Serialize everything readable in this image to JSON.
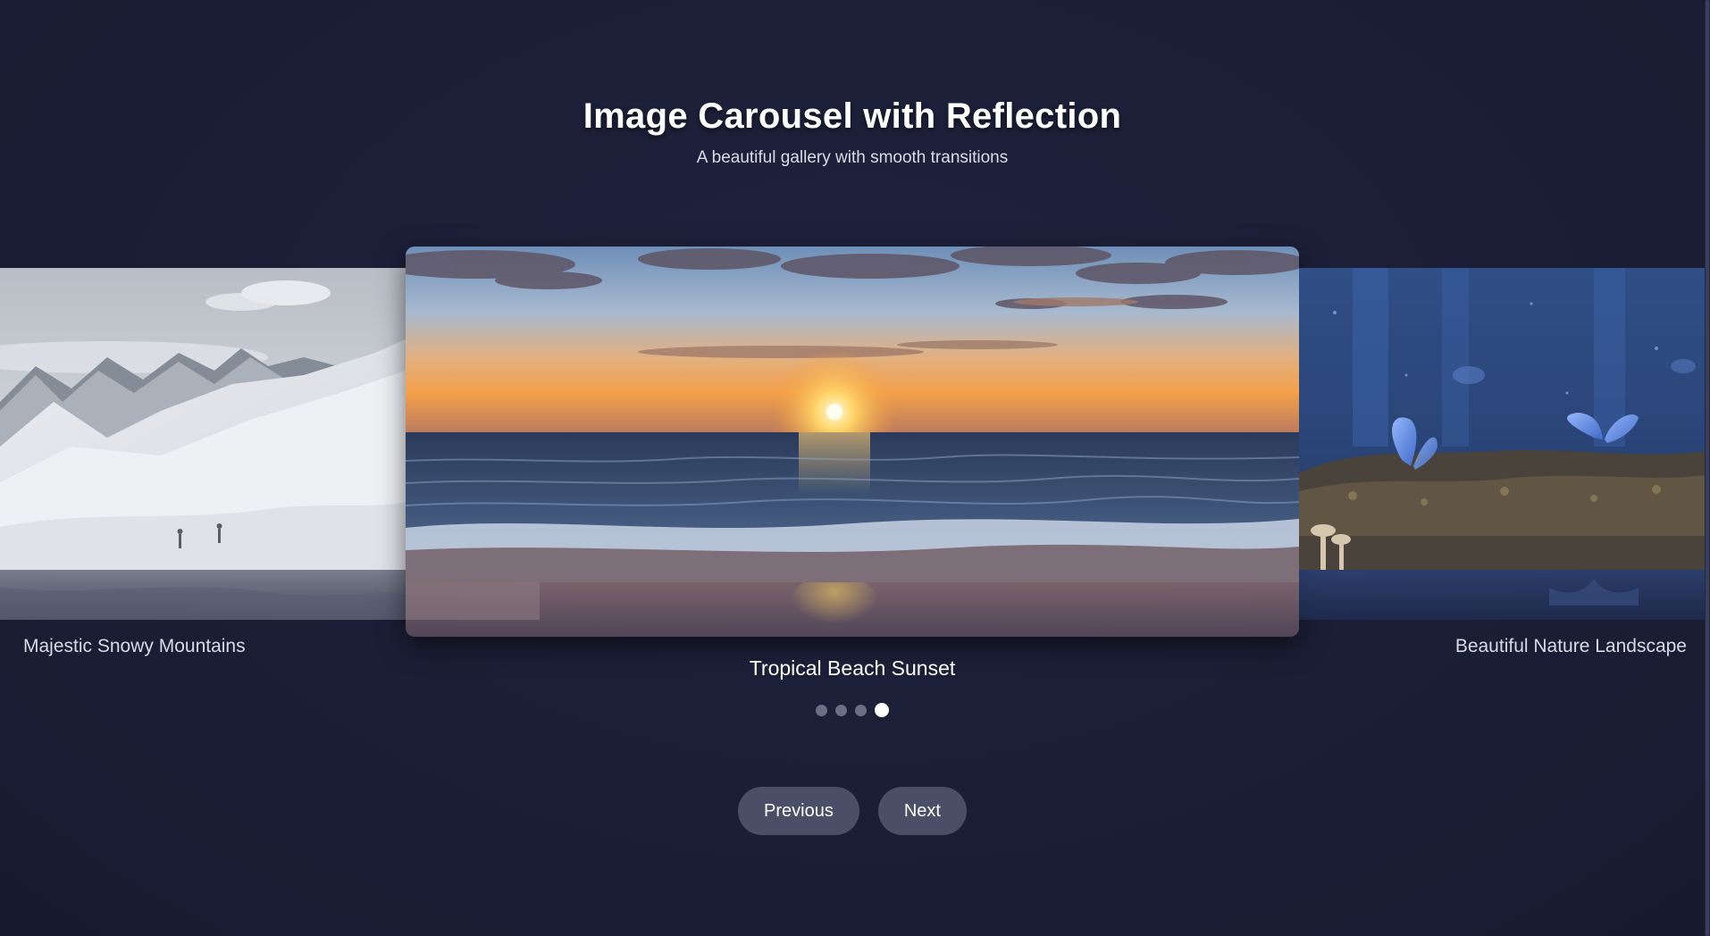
{
  "header": {
    "title": "Image Carousel with Reflection",
    "subtitle": "A beautiful gallery with smooth transitions"
  },
  "slides": [
    {
      "caption": "Majestic Snowy Mountains",
      "position": "left"
    },
    {
      "caption": "Tropical Beach Sunset",
      "position": "center",
      "active": true
    },
    {
      "caption": "Beautiful Nature Landscape",
      "position": "right"
    }
  ],
  "pagination": {
    "total": 4,
    "active_index": 3
  },
  "controls": {
    "previous_label": "Previous",
    "next_label": "Next"
  },
  "colors": {
    "background": "#1b1e35",
    "button": "#4a4e67",
    "dot_inactive": "#6b6f84",
    "dot_active": "#ffffff"
  }
}
